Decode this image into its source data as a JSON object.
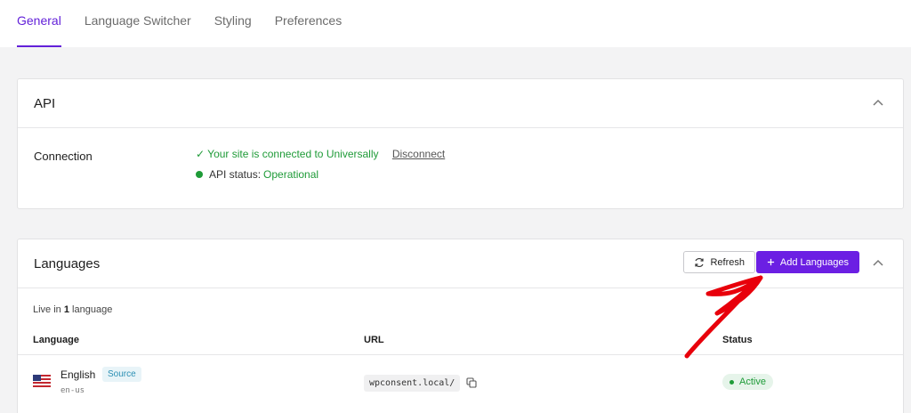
{
  "tabs": [
    {
      "label": "General",
      "active": true
    },
    {
      "label": "Language Switcher",
      "active": false
    },
    {
      "label": "Styling",
      "active": false
    },
    {
      "label": "Preferences",
      "active": false
    }
  ],
  "api": {
    "title": "API",
    "connection_label": "Connection",
    "connected_text": "✓ Your site is connected to Universally",
    "disconnect_label": "Disconnect",
    "status_prefix": "API status:",
    "status_value": "Operational"
  },
  "languages": {
    "title": "Languages",
    "refresh_label": "Refresh",
    "add_label": "Add Languages",
    "live_prefix": "Live in",
    "live_count": "1",
    "live_suffix": "language",
    "columns": [
      "Language",
      "URL",
      "Status"
    ],
    "rows": [
      {
        "name": "English",
        "badge": "Source",
        "code": "en-us",
        "url": "wpconsent.local/",
        "status": "Active"
      }
    ]
  },
  "colors": {
    "accent": "#6b1fe3",
    "success": "#1f9b38",
    "annotation": "#e8000b"
  }
}
